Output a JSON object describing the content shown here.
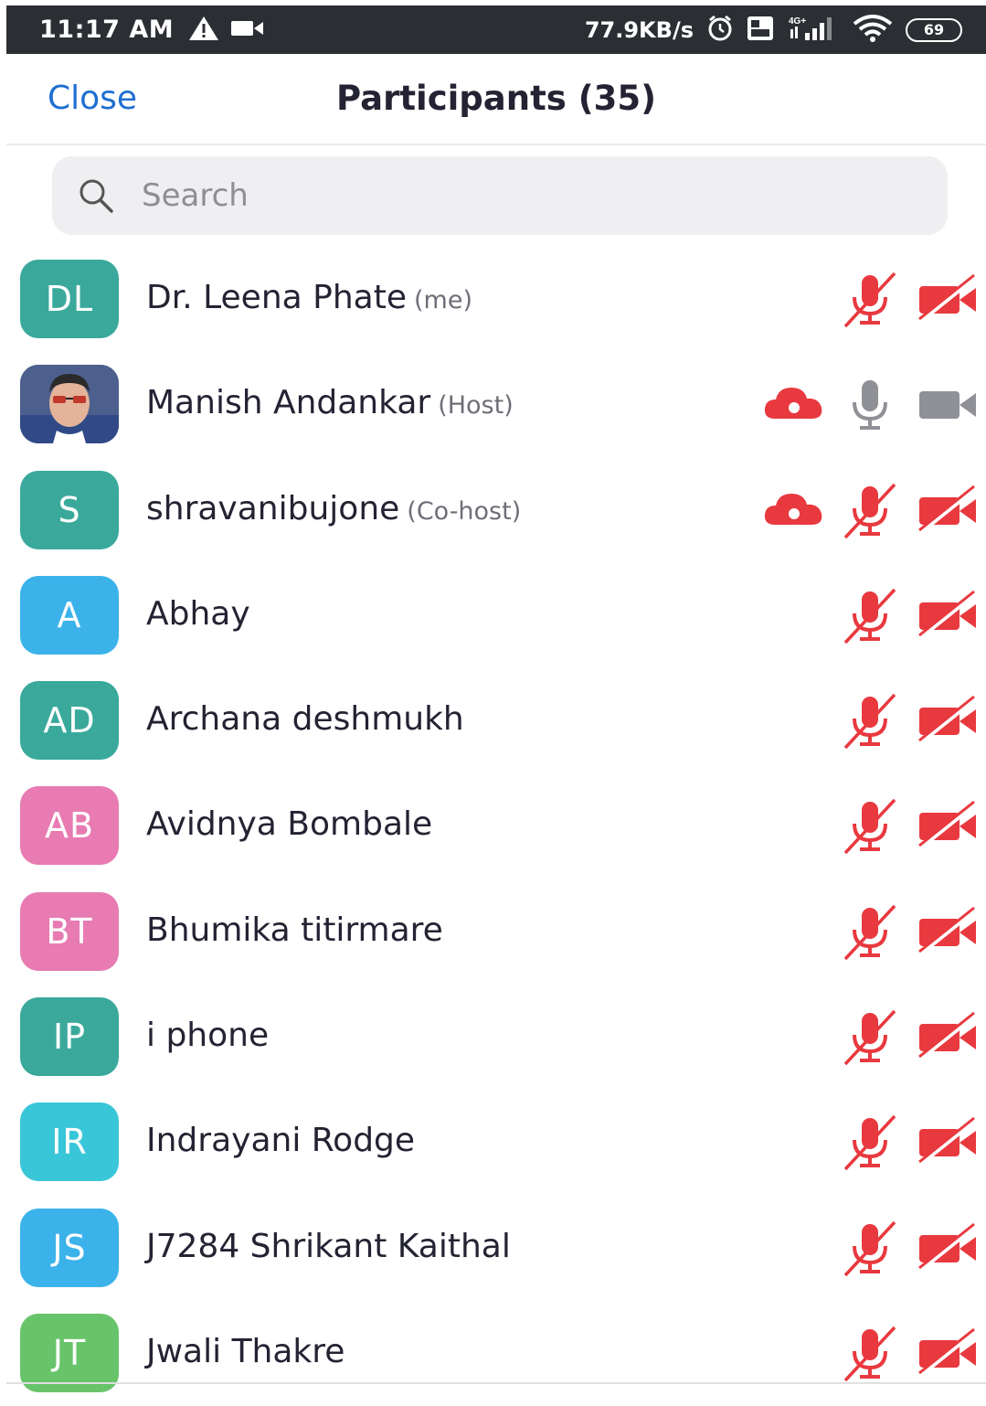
{
  "status_bar": {
    "time": "11:17 AM",
    "speed": "77.9KB/s",
    "battery": "69",
    "network_label": "4G+",
    "volte_label": "Vo LTE",
    "icons": [
      "alert-triangle-icon",
      "video-record-icon",
      "alarm-icon",
      "volte-icon",
      "signal-icon",
      "wifi-icon",
      "battery-icon"
    ]
  },
  "header": {
    "close_label": "Close",
    "title": "Participants (35)"
  },
  "search": {
    "placeholder": "Search"
  },
  "colors": {
    "accent": "#1f6fd2",
    "muted_red": "#e8393f",
    "active_gray": "#8f9196"
  },
  "participants": [
    {
      "initials": "DL",
      "name": "Dr. Leena Phate",
      "role": "(me)",
      "avatar_color": "#3aa99b",
      "cloud": false,
      "mic": "muted",
      "video": "off"
    },
    {
      "initials": "",
      "name": "Manish Andankar",
      "role": "(Host)",
      "avatar_color": "#5b6f9a",
      "photo": true,
      "cloud": true,
      "mic": "on",
      "video": "on"
    },
    {
      "initials": "S",
      "name": "shravanibujone",
      "role": "(Co-host)",
      "avatar_color": "#3aa99b",
      "cloud": true,
      "mic": "muted",
      "video": "off"
    },
    {
      "initials": "A",
      "name": "Abhay",
      "role": "",
      "avatar_color": "#3bb2ea",
      "cloud": false,
      "mic": "muted",
      "video": "off"
    },
    {
      "initials": "AD",
      "name": "Archana deshmukh",
      "role": "",
      "avatar_color": "#3aa99b",
      "cloud": false,
      "mic": "muted",
      "video": "off"
    },
    {
      "initials": "AB",
      "name": "Avidnya Bombale",
      "role": "",
      "avatar_color": "#e77bb2",
      "cloud": false,
      "mic": "muted",
      "video": "off"
    },
    {
      "initials": "BT",
      "name": "Bhumika titirmare",
      "role": "",
      "avatar_color": "#e77bb2",
      "cloud": false,
      "mic": "muted",
      "video": "off"
    },
    {
      "initials": "IP",
      "name": "i phone",
      "role": "",
      "avatar_color": "#3aa99b",
      "cloud": false,
      "mic": "muted",
      "video": "off"
    },
    {
      "initials": "IR",
      "name": "Indrayani Rodge",
      "role": "",
      "avatar_color": "#39c6d8",
      "cloud": false,
      "mic": "muted",
      "video": "off"
    },
    {
      "initials": "JS",
      "name": "J7284 Shrikant Kaithal",
      "role": "",
      "avatar_color": "#3bb2ea",
      "cloud": false,
      "mic": "muted",
      "video": "off"
    },
    {
      "initials": "JT",
      "name": "Jwali Thakre",
      "role": "",
      "avatar_color": "#68c46a",
      "cloud": false,
      "mic": "muted",
      "video": "off"
    }
  ]
}
